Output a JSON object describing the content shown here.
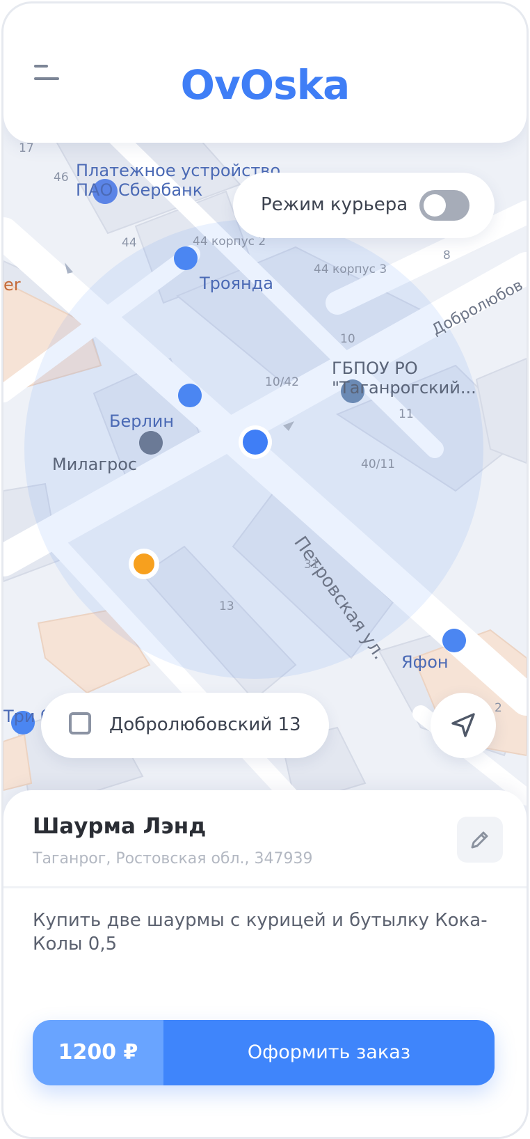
{
  "app": {
    "logo_text": "OvOska",
    "brand_color": "#3f7ef6"
  },
  "header": {
    "menu_icon": "menu-icon"
  },
  "courier_mode": {
    "label": "Режим курьера",
    "enabled": false
  },
  "map": {
    "pois": [
      {
        "id": "sberbank-1",
        "label": "Платежное устройство"
      },
      {
        "id": "sberbank-2",
        "label": "ПАО Сбербанк"
      },
      {
        "id": "troyanda",
        "label": "Троянда"
      },
      {
        "id": "gbpou-1",
        "label": "ГБПОУ РО"
      },
      {
        "id": "gbpou-2",
        "label": "\"Таганрогский..."
      },
      {
        "id": "berlin",
        "label": "Берлин"
      },
      {
        "id": "milagros",
        "label": "Милагрос"
      },
      {
        "id": "yafon",
        "label": "Яфон"
      },
      {
        "id": "tri",
        "label": "Три б"
      },
      {
        "id": "er",
        "label": "er"
      }
    ],
    "streets": [
      {
        "id": "petrovskaya",
        "label": "Петровская ул."
      },
      {
        "id": "dobrolyubov",
        "label": "Добролюбов"
      }
    ],
    "building_numbers": [
      "17",
      "46",
      "44",
      "44 корпус 2",
      "44 корпус 3",
      "8",
      "10",
      "10/42",
      "11",
      "40/11",
      "31",
      "13",
      "2"
    ]
  },
  "address_pill": {
    "text": "Добролюбовский 13",
    "checked": false
  },
  "locate_button": {
    "icon": "navigation-arrow-icon"
  },
  "sheet": {
    "place_name": "Шаурма Лэнд",
    "place_address": "Таганрог, Ростовская обл., 347939",
    "edit_icon": "pencil-icon",
    "note": "Купить две шаурмы с курицей и бутылку Кока-Колы 0,5",
    "price": "1200 ₽",
    "order_label": "Оформить заказ"
  }
}
